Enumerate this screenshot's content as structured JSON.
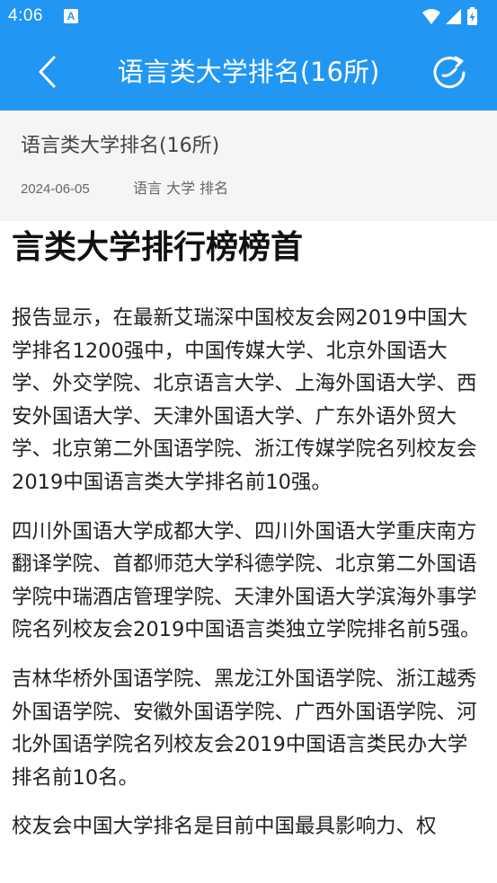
{
  "status_bar": {
    "time": "4:06",
    "notification_icon": "A",
    "icons": [
      "wifi-icon",
      "signal-icon",
      "battery-charging-icon"
    ]
  },
  "app_bar": {
    "title": "语言类大学排名(16所)",
    "back_icon": "chevron-left-icon",
    "refresh_icon": "refresh-icon"
  },
  "article": {
    "title": "语言类大学排名(16所)",
    "date": "2024-06-05",
    "tags": "语言 大学 排名"
  },
  "content": {
    "heading": "言类大学排行榜榜首",
    "paragraphs": [
      "报告显示，在最新艾瑞深中国校友会网2019中国大学排名1200强中，中国传媒大学、北京外国语大学、外交学院、北京语言大学、上海外国语大学、西安外国语大学、天津外国语大学、广东外语外贸大学、北京第二外国语学院、浙江传媒学院名列校友会2019中国语言类大学排名前10强。",
      "四川外国语大学成都大学、四川外国语大学重庆南方翻译学院、首都师范大学科德学院、北京第二外国语学院中瑞酒店管理学院、天津外国语大学滨海外事学院名列校友会2019中国语言类独立学院排名前5强。",
      "吉林华桥外国语学院、黑龙江外国语学院、浙江越秀外国语学院、安徽外国语学院、广西外国语学院、河北外国语学院名列校友会2019中国语言类民办大学排名前10名。",
      "校友会中国大学排名是目前中国最具影响力、权"
    ]
  },
  "colors": {
    "primary": "#2196f3",
    "meta_background": "#f5f5f5",
    "text": "#222222",
    "secondary_text": "#666666"
  }
}
